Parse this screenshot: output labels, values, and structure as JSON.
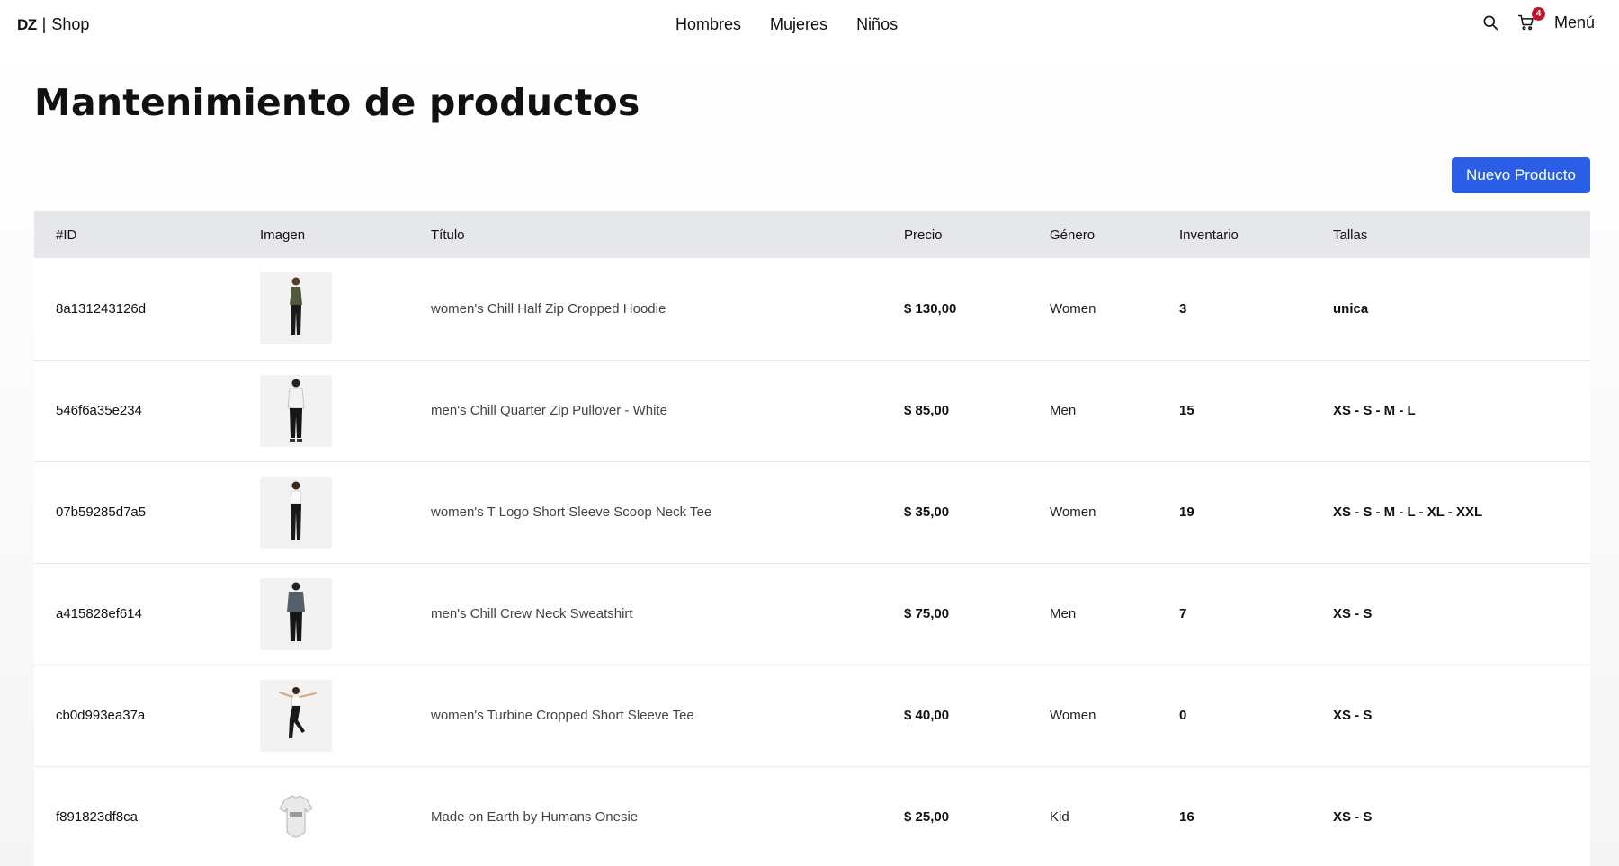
{
  "navbar": {
    "brand_logo": "DZ",
    "brand_sep": "|",
    "brand_name": "Shop",
    "links": [
      "Hombres",
      "Mujeres",
      "Niños"
    ],
    "search_icon": "search-icon",
    "cart_icon": "cart-icon",
    "cart_count": "4",
    "menu_label": "Menú"
  },
  "main": {
    "title": "Mantenimiento de productos",
    "new_button": "Nuevo Producto"
  },
  "table": {
    "headers": [
      "#ID",
      "Imagen",
      "Título",
      "Precio",
      "Género",
      "Inventario",
      "Tallas"
    ],
    "rows": [
      {
        "id": "8a131243126d",
        "image": "woman-standing-hoodie",
        "title": "women's Chill Half Zip Cropped Hoodie",
        "price": "$ 130,00",
        "gender": "Women",
        "inventory": "3",
        "sizes": "unica"
      },
      {
        "id": "546f6a35e234",
        "image": "man-standing-white-pullover",
        "title": "men's Chill Quarter Zip Pullover - White",
        "price": "$ 85,00",
        "gender": "Men",
        "inventory": "15",
        "sizes": "XS - S - M - L"
      },
      {
        "id": "07b59285d7a5",
        "image": "woman-standing-white-tee",
        "title": "women's T Logo Short Sleeve Scoop Neck Tee",
        "price": "$ 35,00",
        "gender": "Women",
        "inventory": "19",
        "sizes": "XS - S - M - L - XL - XXL"
      },
      {
        "id": "a415828ef614",
        "image": "man-standing-gray-sweatshirt",
        "title": "men's Chill Crew Neck Sweatshirt",
        "price": "$ 75,00",
        "gender": "Men",
        "inventory": "7",
        "sizes": "XS - S"
      },
      {
        "id": "cb0d993ea37a",
        "image": "woman-jumping-white-tee",
        "title": "women's Turbine Cropped Short Sleeve Tee",
        "price": "$ 40,00",
        "gender": "Women",
        "inventory": "0",
        "sizes": "XS - S"
      },
      {
        "id": "f891823df8ca",
        "image": "baby-onesie",
        "title": "Made on Earth by Humans Onesie",
        "price": "$ 25,00",
        "gender": "Kid",
        "inventory": "16",
        "sizes": "XS - S"
      }
    ]
  },
  "colors": {
    "primary_button": "#2b5ee6",
    "badge": "#c2152a",
    "table_header": "#e5e7eb"
  }
}
